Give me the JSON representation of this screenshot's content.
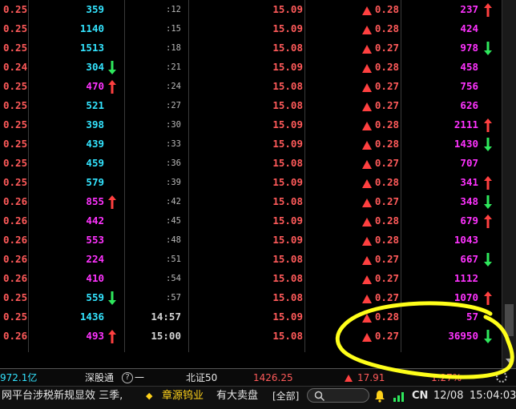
{
  "rows": [
    {
      "p": "0.25",
      "v": "359",
      "vc": "cyan",
      "a1": "",
      "t": ":12",
      "tf": false,
      "price": "15.09",
      "chg": "0.28",
      "num": "237",
      "a2": "up"
    },
    {
      "p": "0.25",
      "v": "1140",
      "vc": "cyan",
      "a1": "",
      "t": ":15",
      "tf": false,
      "price": "15.09",
      "chg": "0.28",
      "num": "424",
      "a2": ""
    },
    {
      "p": "0.25",
      "v": "1513",
      "vc": "cyan",
      "a1": "",
      "t": ":18",
      "tf": false,
      "price": "15.08",
      "chg": "0.27",
      "num": "978",
      "a2": "down"
    },
    {
      "p": "0.24",
      "v": "304",
      "vc": "cyan",
      "a1": "down",
      "t": ":21",
      "tf": false,
      "price": "15.09",
      "chg": "0.28",
      "num": "458",
      "a2": ""
    },
    {
      "p": "0.25",
      "v": "470",
      "vc": "mag",
      "a1": "up",
      "t": ":24",
      "tf": false,
      "price": "15.08",
      "chg": "0.27",
      "num": "756",
      "a2": ""
    },
    {
      "p": "0.25",
      "v": "521",
      "vc": "cyan",
      "a1": "",
      "t": ":27",
      "tf": false,
      "price": "15.08",
      "chg": "0.27",
      "num": "626",
      "a2": ""
    },
    {
      "p": "0.25",
      "v": "398",
      "vc": "cyan",
      "a1": "",
      "t": ":30",
      "tf": false,
      "price": "15.09",
      "chg": "0.28",
      "num": "2111",
      "a2": "up"
    },
    {
      "p": "0.25",
      "v": "439",
      "vc": "cyan",
      "a1": "",
      "t": ":33",
      "tf": false,
      "price": "15.09",
      "chg": "0.28",
      "num": "1430",
      "a2": "down"
    },
    {
      "p": "0.25",
      "v": "459",
      "vc": "cyan",
      "a1": "",
      "t": ":36",
      "tf": false,
      "price": "15.08",
      "chg": "0.27",
      "num": "707",
      "a2": ""
    },
    {
      "p": "0.25",
      "v": "579",
      "vc": "cyan",
      "a1": "",
      "t": ":39",
      "tf": false,
      "price": "15.09",
      "chg": "0.28",
      "num": "341",
      "a2": "up"
    },
    {
      "p": "0.26",
      "v": "855",
      "vc": "mag",
      "a1": "up",
      "t": ":42",
      "tf": false,
      "price": "15.08",
      "chg": "0.27",
      "num": "348",
      "a2": "down"
    },
    {
      "p": "0.26",
      "v": "442",
      "vc": "mag",
      "a1": "",
      "t": ":45",
      "tf": false,
      "price": "15.09",
      "chg": "0.28",
      "num": "679",
      "a2": "up"
    },
    {
      "p": "0.26",
      "v": "553",
      "vc": "mag",
      "a1": "",
      "t": ":48",
      "tf": false,
      "price": "15.09",
      "chg": "0.28",
      "num": "1043",
      "a2": ""
    },
    {
      "p": "0.26",
      "v": "224",
      "vc": "mag",
      "a1": "",
      "t": ":51",
      "tf": false,
      "price": "15.08",
      "chg": "0.27",
      "num": "667",
      "a2": "down"
    },
    {
      "p": "0.26",
      "v": "410",
      "vc": "mag",
      "a1": "",
      "t": ":54",
      "tf": false,
      "price": "15.08",
      "chg": "0.27",
      "num": "1112",
      "a2": ""
    },
    {
      "p": "0.25",
      "v": "559",
      "vc": "cyan",
      "a1": "down",
      "t": ":57",
      "tf": false,
      "price": "15.08",
      "chg": "0.27",
      "num": "1070",
      "a2": "up"
    },
    {
      "p": "0.25",
      "v": "1436",
      "vc": "cyan",
      "a1": "",
      "t": "14:57",
      "tf": true,
      "price": "15.09",
      "chg": "0.28",
      "num": "57",
      "a2": ""
    },
    {
      "p": "0.26",
      "v": "493",
      "vc": "mag",
      "a1": "up",
      "t": "15:00",
      "tf": true,
      "price": "15.08",
      "chg": "0.27",
      "num": "36950",
      "a2": "down"
    }
  ],
  "ticker": {
    "amount": "972.1亿",
    "index1_name": "深股通",
    "index1_help": "?",
    "index1_value": "一",
    "index2_name": "北证50",
    "index2_value": "1426.25",
    "index2_change": "17.91",
    "index2_pct": "1.27%"
  },
  "status": {
    "news": "网平台涉税新规显效  三季,",
    "diamond": "◆",
    "alert_stock": "章源钨业",
    "alert_text": "有大卖盘",
    "scope": "[全部]",
    "region": "CN",
    "date": "12/08",
    "time": "15:04:03"
  },
  "colors": {
    "up": "#ff4040",
    "down": "#2ee85c",
    "cyan": "#33e4ff",
    "magenta": "#ff33ff",
    "annotation": "#ffff1a"
  }
}
